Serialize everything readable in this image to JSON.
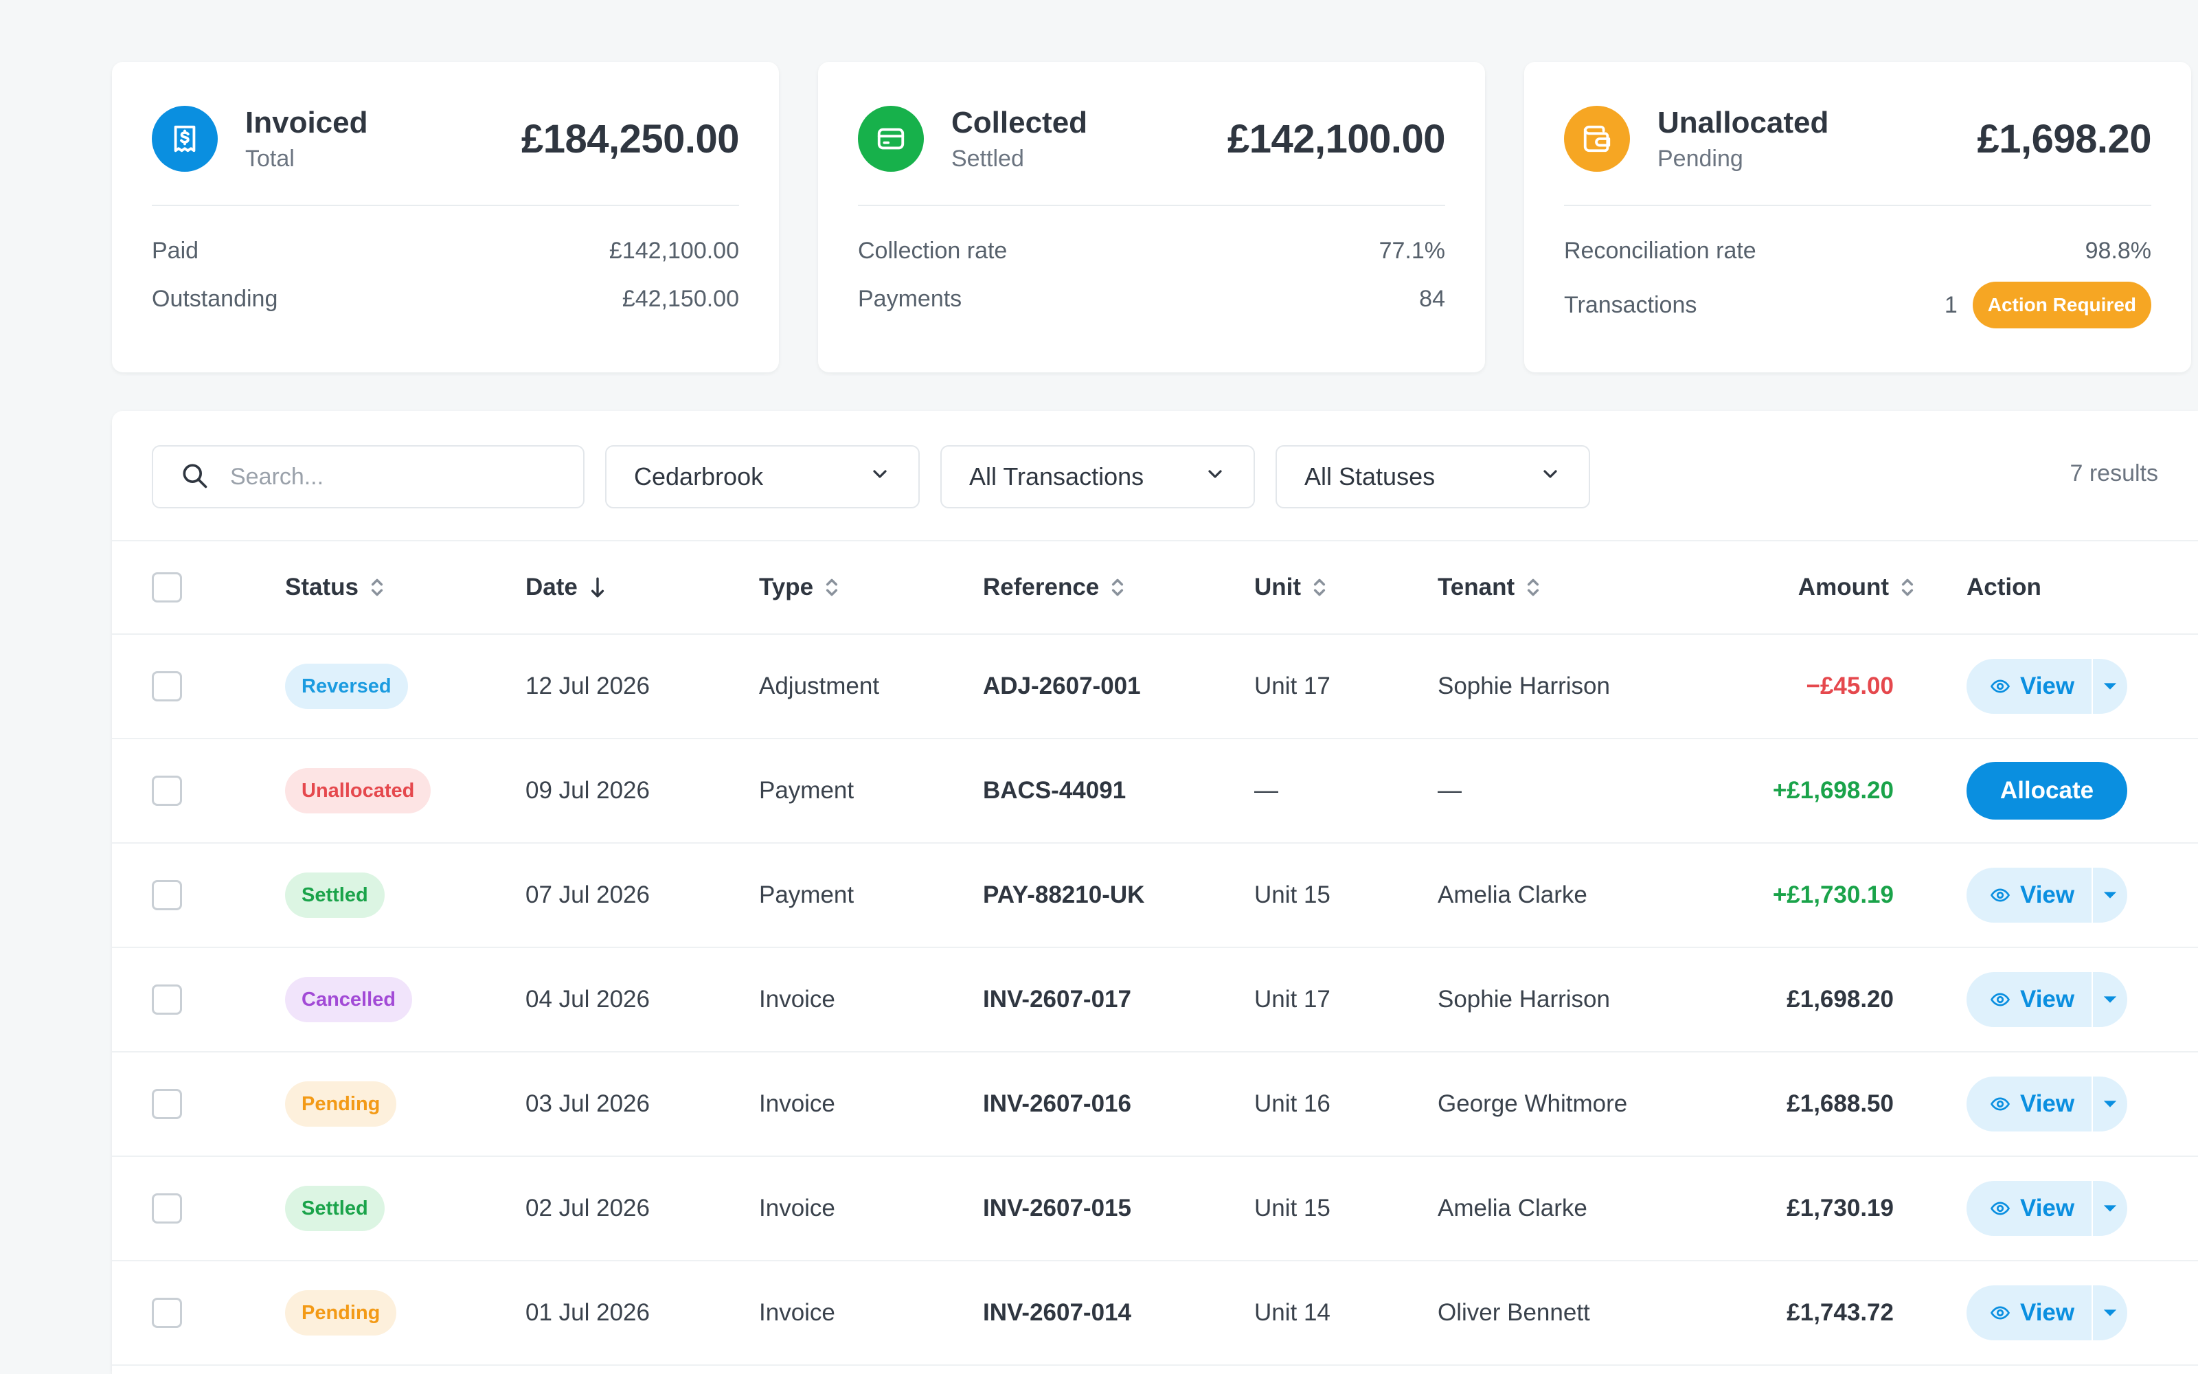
{
  "stats": [
    {
      "title": "Invoiced",
      "subtitle": "Total",
      "total": "£184,250.00",
      "icon": "receipt-icon",
      "icon_color": "#0a8fe0",
      "rows": [
        {
          "label": "Paid",
          "value": "£142,100.00"
        },
        {
          "label": "Outstanding",
          "value": "£42,150.00"
        }
      ]
    },
    {
      "title": "Collected",
      "subtitle": "Settled",
      "total": "£142,100.00",
      "icon": "card-icon",
      "icon_color": "#17b14b",
      "rows": [
        {
          "label": "Collection rate",
          "value": "77.1%"
        },
        {
          "label": "Payments",
          "value": "84"
        }
      ]
    },
    {
      "title": "Unallocated",
      "subtitle": "Pending",
      "total": "£1,698.20",
      "icon": "wallet-icon",
      "icon_color": "#f6a623",
      "rows": [
        {
          "label": "Reconciliation rate",
          "value": "98.8%"
        },
        {
          "label": "Transactions",
          "value": "1",
          "badge": "Action Required"
        }
      ]
    }
  ],
  "filters": {
    "search_placeholder": "Search...",
    "property": "Cedarbrook",
    "type": "All Transactions",
    "status": "All Statuses",
    "results": "7 results"
  },
  "table": {
    "headers": {
      "status": "Status",
      "date": "Date",
      "type": "Type",
      "reference": "Reference",
      "unit": "Unit",
      "tenant": "Tenant",
      "amount": "Amount",
      "action": "Action"
    },
    "rows": [
      {
        "status": "Reversed",
        "status_bg": "#dff1fc",
        "status_fg": "#1b9be0",
        "date": "12 Jul 2026",
        "type": "Adjustment",
        "reference": "ADJ-2607-001",
        "unit": "Unit 17",
        "tenant": "Sophie Harrison",
        "amount": "−£45.00",
        "amount_kind": "neg",
        "action": "View"
      },
      {
        "status": "Unallocated",
        "status_bg": "#fde4e4",
        "status_fg": "#e5484d",
        "date": "09 Jul 2026",
        "type": "Payment",
        "reference": "BACS-44091",
        "unit": "—",
        "tenant": "—",
        "amount": "+£1,698.20",
        "amount_kind": "pos",
        "action": "Allocate"
      },
      {
        "status": "Settled",
        "status_bg": "#dcf5e3",
        "status_fg": "#1aa34a",
        "date": "07 Jul 2026",
        "type": "Payment",
        "reference": "PAY-88210-UK",
        "unit": "Unit 15",
        "tenant": "Amelia Clarke",
        "amount": "+£1,730.19",
        "amount_kind": "pos",
        "action": "View"
      },
      {
        "status": "Cancelled",
        "status_bg": "#f1e4fb",
        "status_fg": "#a24ad6",
        "date": "04 Jul 2026",
        "type": "Invoice",
        "reference": "INV-2607-017",
        "unit": "Unit 17",
        "tenant": "Sophie Harrison",
        "amount": "£1,698.20",
        "amount_kind": "plain",
        "action": "View"
      },
      {
        "status": "Pending",
        "status_bg": "#fdf0dc",
        "status_fg": "#f39a16",
        "date": "03 Jul 2026",
        "type": "Invoice",
        "reference": "INV-2607-016",
        "unit": "Unit 16",
        "tenant": "George Whitmore",
        "amount": "£1,688.50",
        "amount_kind": "plain",
        "action": "View"
      },
      {
        "status": "Settled",
        "status_bg": "#dcf5e3",
        "status_fg": "#1aa34a",
        "date": "02 Jul 2026",
        "type": "Invoice",
        "reference": "INV-2607-015",
        "unit": "Unit 15",
        "tenant": "Amelia Clarke",
        "amount": "£1,730.19",
        "amount_kind": "plain",
        "action": "View"
      },
      {
        "status": "Pending",
        "status_bg": "#fdf0dc",
        "status_fg": "#f39a16",
        "date": "01 Jul 2026",
        "type": "Invoice",
        "reference": "INV-2607-014",
        "unit": "Unit 14",
        "tenant": "Oliver Bennett",
        "amount": "£1,743.72",
        "amount_kind": "plain",
        "action": "View"
      }
    ]
  }
}
